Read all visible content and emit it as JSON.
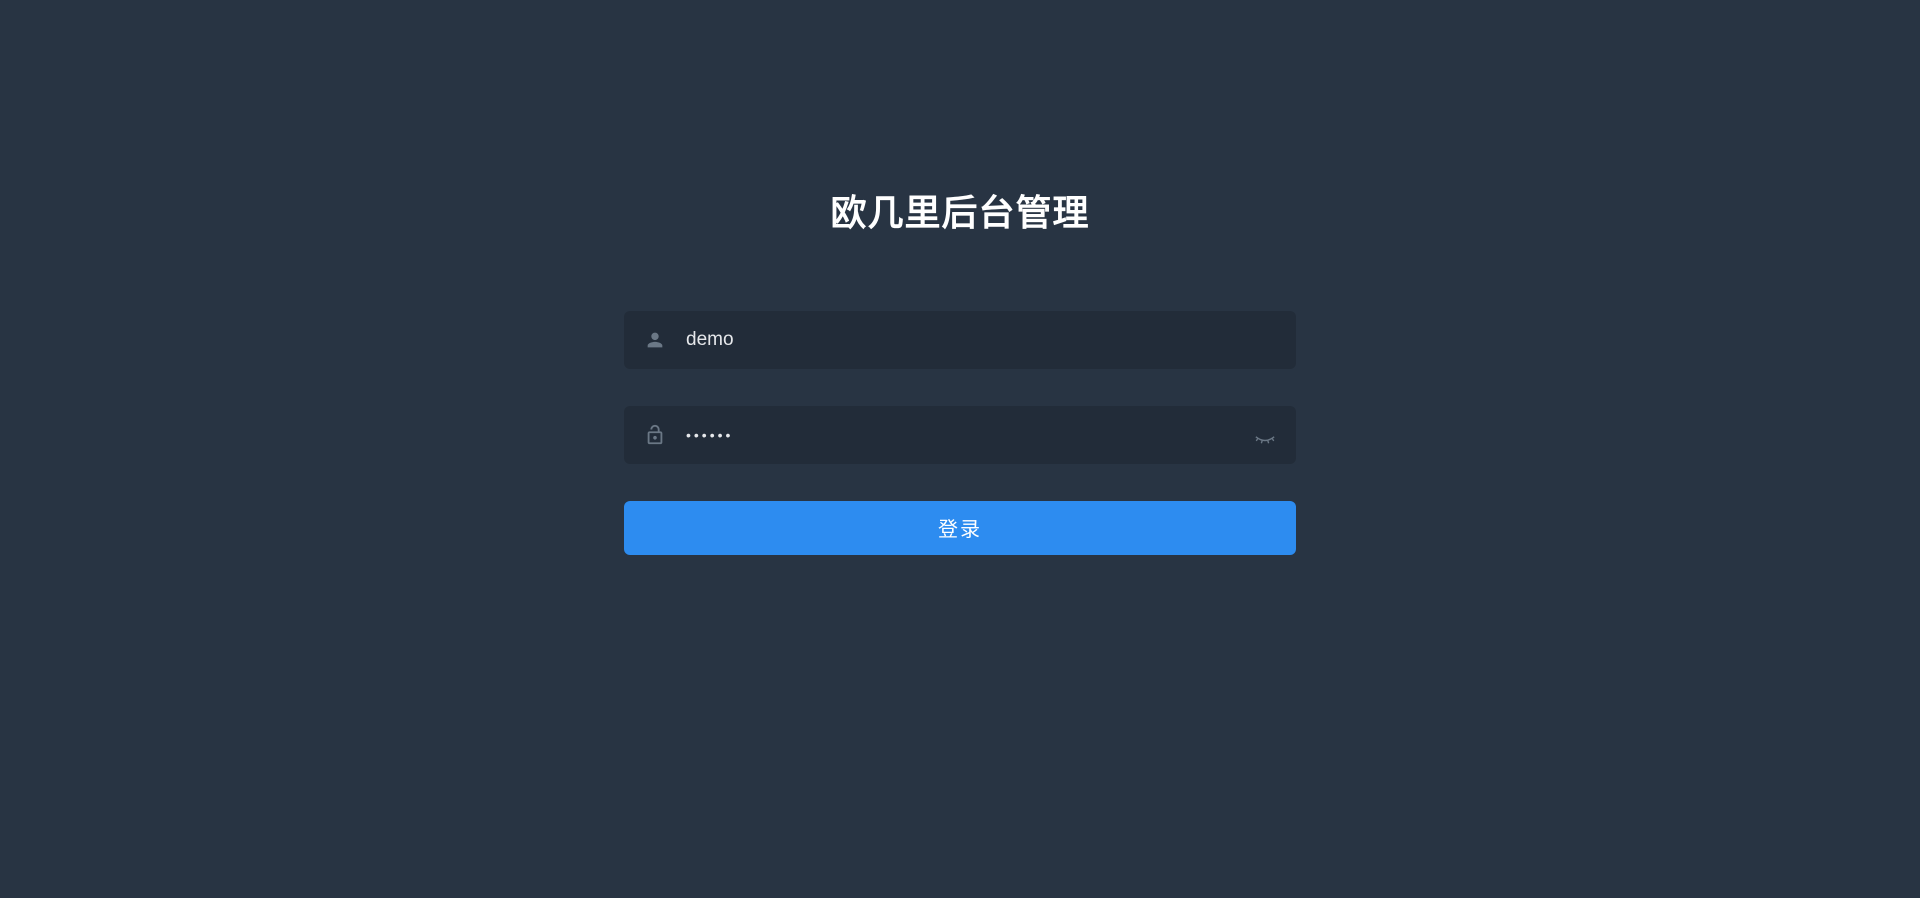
{
  "login": {
    "title": "欧几里后台管理",
    "username": {
      "value": "demo",
      "placeholder": ""
    },
    "password": {
      "value": "••••••",
      "placeholder": ""
    },
    "submit_label": "登录"
  }
}
